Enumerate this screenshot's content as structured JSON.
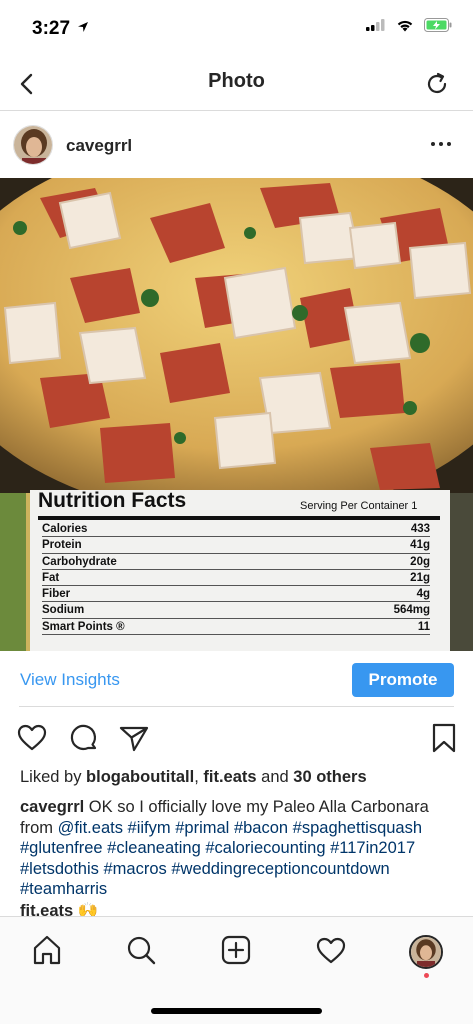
{
  "status": {
    "time": "3:27"
  },
  "nav": {
    "title": "Photo"
  },
  "post": {
    "username": "cavegrrl"
  },
  "nutrition": {
    "title": "Nutrition Facts",
    "serving": "Serving Per Container 1",
    "rows": [
      {
        "label": "Calories",
        "value": "433"
      },
      {
        "label": "Protein",
        "value": "41g"
      },
      {
        "label": "Carbohydrate",
        "value": "20g"
      },
      {
        "label": "Fat",
        "value": "21g"
      },
      {
        "label": "Fiber",
        "value": "4g"
      },
      {
        "label": "Sodium",
        "value": "564mg"
      },
      {
        "label": "Smart Points ®",
        "value": "11"
      }
    ]
  },
  "insights": {
    "link": "View Insights",
    "promote": "Promote"
  },
  "likes": {
    "prefix": "Liked by ",
    "user1": "blogaboutitall",
    "sep": ", ",
    "user2": "fit.eats",
    "and": " and ",
    "others": "30 others"
  },
  "caption": {
    "user": "cavegrrl",
    "text": " OK so I officially love my Paleo Alla Carbonara from ",
    "mention": "@fit.eats",
    "tags": [
      "#iifym",
      "#primal",
      "#bacon",
      "#spaghettisquash",
      "#glutenfree",
      "#cleaneating",
      "#caloriecounting",
      "#117in2017",
      "#letsdothis",
      "#macros",
      "#weddingreceptioncountdown",
      "#teamharris"
    ]
  },
  "comment_peek": "fit.eats 🙌",
  "colors": {
    "accent": "#3897f0",
    "hashtag": "#003569",
    "notification": "#ed4956"
  }
}
